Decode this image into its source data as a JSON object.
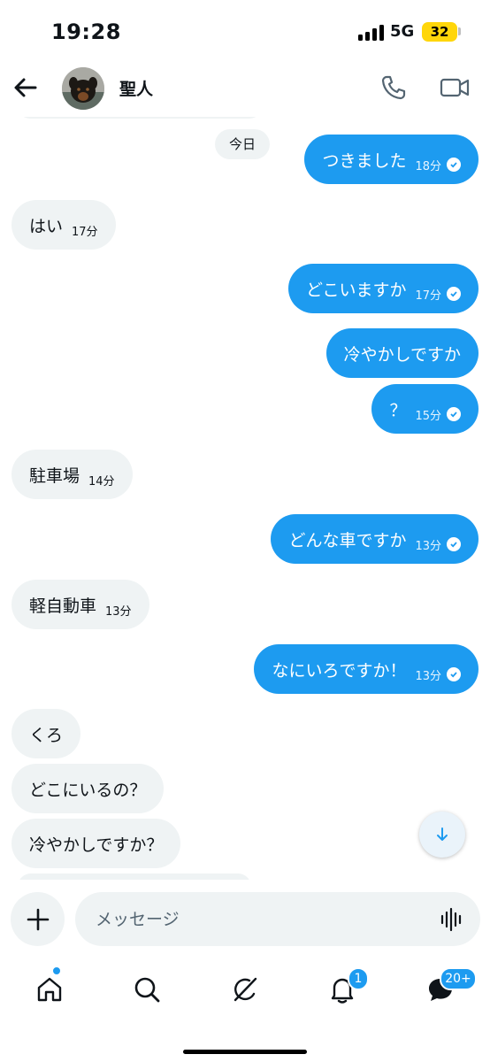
{
  "status_bar": {
    "time": "19:28",
    "network": "5G",
    "battery": "32"
  },
  "header": {
    "contact_name": "聖人",
    "back_icon": "arrow-left-icon",
    "call_icon": "phone-icon",
    "video_icon": "video-camera-icon"
  },
  "chat": {
    "day_label": "今日",
    "messages": [
      {
        "direction": "out",
        "text": "つきました",
        "time": "18分",
        "read": true
      },
      {
        "direction": "in",
        "text": "はい",
        "time": "17分"
      },
      {
        "direction": "out",
        "text": "どこいますか",
        "time": "17分",
        "read": true
      },
      {
        "direction": "out",
        "text": "冷やかしですか",
        "time": ""
      },
      {
        "direction": "out",
        "text": "？",
        "time": "15分",
        "read": true
      },
      {
        "direction": "in",
        "text": "駐車場",
        "time": "14分"
      },
      {
        "direction": "out",
        "text": "どんな車ですか",
        "time": "13分",
        "read": true
      },
      {
        "direction": "in",
        "text": "軽自動車",
        "time": "13分"
      },
      {
        "direction": "out",
        "text": "なにいろですか！",
        "time": "13分",
        "read": true
      },
      {
        "direction": "in",
        "text": "くろ",
        "time": ""
      },
      {
        "direction": "in",
        "text": "どこにいるの？",
        "time": ""
      },
      {
        "direction": "in",
        "text": "冷やかしですか？",
        "time": ""
      }
    ]
  },
  "composer": {
    "placeholder": "メッセージ",
    "add_icon": "plus-icon",
    "voice_icon": "voice-waveform-icon"
  },
  "bottom_nav": {
    "items": [
      {
        "icon": "home-icon",
        "has_dot": true
      },
      {
        "icon": "search-icon"
      },
      {
        "icon": "grok-icon"
      },
      {
        "icon": "notifications-bell-icon",
        "badge": "1"
      },
      {
        "icon": "messages-icon",
        "badge": "20+"
      }
    ]
  },
  "colors": {
    "accent": "#1d9bf0",
    "bubble_in": "#eff3f4",
    "text": "#0f1419"
  }
}
